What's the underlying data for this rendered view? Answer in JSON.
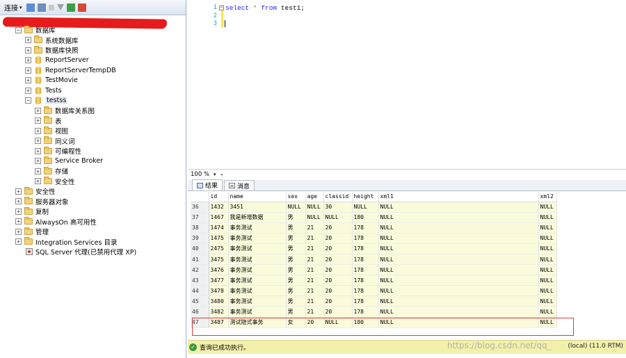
{
  "explorer": {
    "toolbar": {
      "connect_label": "连接"
    },
    "tree": [
      {
        "label": "数据库",
        "level": 0,
        "kind": "folder",
        "expand": "-"
      },
      {
        "label": "系统数据库",
        "level": 1,
        "kind": "folder",
        "expand": "+"
      },
      {
        "label": "数据库快照",
        "level": 1,
        "kind": "folder",
        "expand": "+"
      },
      {
        "label": "ReportServer",
        "level": 1,
        "kind": "db",
        "expand": "+"
      },
      {
        "label": "ReportServerTempDB",
        "level": 1,
        "kind": "db",
        "expand": "+"
      },
      {
        "label": "TestMovie",
        "level": 1,
        "kind": "db",
        "expand": "+"
      },
      {
        "label": "Tests",
        "level": 1,
        "kind": "db",
        "expand": "+"
      },
      {
        "label": "testss",
        "level": 1,
        "kind": "db",
        "expand": "-",
        "selected": true
      },
      {
        "label": "数据库关系图",
        "level": 2,
        "kind": "folder",
        "expand": "+"
      },
      {
        "label": "表",
        "level": 2,
        "kind": "folder",
        "expand": "+"
      },
      {
        "label": "视图",
        "level": 2,
        "kind": "folder",
        "expand": "+"
      },
      {
        "label": "同义词",
        "level": 2,
        "kind": "folder",
        "expand": "+"
      },
      {
        "label": "可编程性",
        "level": 2,
        "kind": "folder",
        "expand": "+"
      },
      {
        "label": "Service Broker",
        "level": 2,
        "kind": "folder",
        "expand": "+"
      },
      {
        "label": "存储",
        "level": 2,
        "kind": "folder",
        "expand": "+"
      },
      {
        "label": "安全性",
        "level": 2,
        "kind": "folder",
        "expand": "+"
      },
      {
        "label": "安全性",
        "level": 0,
        "kind": "folder",
        "expand": "+"
      },
      {
        "label": "服务器对象",
        "level": 0,
        "kind": "folder",
        "expand": "+"
      },
      {
        "label": "复制",
        "level": 0,
        "kind": "folder",
        "expand": "+"
      },
      {
        "label": "AlwaysOn 高可用性",
        "level": 0,
        "kind": "folder",
        "expand": "+"
      },
      {
        "label": "管理",
        "level": 0,
        "kind": "folder",
        "expand": "+"
      },
      {
        "label": "Integration Services 目录",
        "level": 0,
        "kind": "folder",
        "expand": "+"
      },
      {
        "label": "SQL Server 代理(已禁用代理 XP)",
        "level": 0,
        "kind": "agent",
        "expand": ""
      }
    ]
  },
  "editor": {
    "line_numbers": [
      "1",
      "2",
      "3"
    ],
    "query": {
      "kw1": "select",
      "star": "*",
      "kw2": "from",
      "table": "test1;"
    }
  },
  "zoom": {
    "value": "100 %"
  },
  "results": {
    "tabs": [
      {
        "label": "结果",
        "active": true
      },
      {
        "label": "消息",
        "active": false
      }
    ],
    "columns": [
      "id",
      "name",
      "sex",
      "age",
      "classid",
      "height",
      "xml1",
      "xml2"
    ],
    "rows": [
      {
        "n": "36",
        "cells": [
          "1432",
          "3451",
          "NULL",
          "NULL",
          "30",
          "NULL",
          "NULL",
          "NULL"
        ]
      },
      {
        "n": "37",
        "cells": [
          "1467",
          "我是新增数据",
          "男",
          "NULL",
          "NULL",
          "180",
          "NULL",
          "NULL"
        ]
      },
      {
        "n": "38",
        "cells": [
          "1474",
          "事务测试",
          "男",
          "21",
          "20",
          "178",
          "NULL",
          "NULL"
        ]
      },
      {
        "n": "39",
        "cells": [
          "1475",
          "事务测试",
          "男",
          "21",
          "20",
          "178",
          "NULL",
          "NULL"
        ]
      },
      {
        "n": "40",
        "cells": [
          "2475",
          "事务测试",
          "男",
          "21",
          "20",
          "178",
          "NULL",
          "NULL"
        ]
      },
      {
        "n": "41",
        "cells": [
          "3475",
          "事务测试",
          "男",
          "21",
          "20",
          "178",
          "NULL",
          "NULL"
        ]
      },
      {
        "n": "42",
        "cells": [
          "3476",
          "事务测试",
          "男",
          "21",
          "20",
          "178",
          "NULL",
          "NULL"
        ]
      },
      {
        "n": "43",
        "cells": [
          "3477",
          "事务测试",
          "男",
          "21",
          "20",
          "178",
          "NULL",
          "NULL"
        ]
      },
      {
        "n": "44",
        "cells": [
          "3478",
          "事务测试",
          "男",
          "21",
          "20",
          "178",
          "NULL",
          "NULL"
        ]
      },
      {
        "n": "45",
        "cells": [
          "3480",
          "事务测试",
          "男",
          "21",
          "20",
          "178",
          "NULL",
          "NULL"
        ]
      },
      {
        "n": "46",
        "cells": [
          "3482",
          "事务测试",
          "男",
          "21",
          "20",
          "178",
          "NULL",
          "NULL"
        ]
      },
      {
        "n": "47",
        "cells": [
          "3487",
          "测试隐式事务",
          "女",
          "20",
          "NULL",
          "180",
          "NULL",
          "NULL"
        ]
      }
    ]
  },
  "status": {
    "message": "查询已成功执行。",
    "server": "(local) (11.0 RTM)",
    "watermark": "https://blog.csdn.net/qq_"
  }
}
